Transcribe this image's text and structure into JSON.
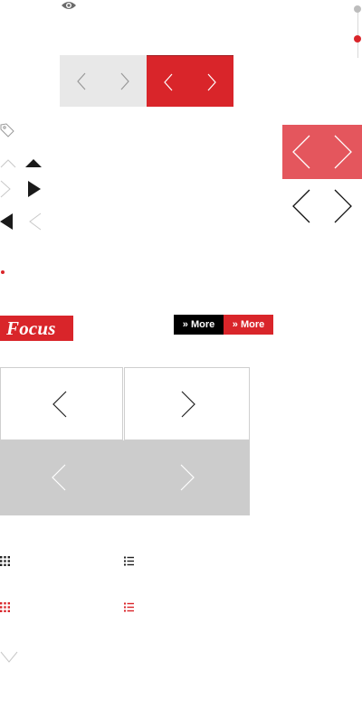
{
  "colors": {
    "accent": "#d9252a",
    "accent_light": "#e4565d",
    "gray_box": "#e8e8e8",
    "gray_band": "#cccccc"
  },
  "icons": {
    "eye": "eye-icon",
    "tag": "tag-icon",
    "arrows": "chevron-left-icon / chevron-right-icon",
    "triangles": "triangle-up / triangle-right / triangle-left",
    "grid": "grid-view-icon",
    "list": "list-view-icon",
    "chevron_down": "chevron-down-icon"
  },
  "slider": {
    "dots": 2,
    "active_index": 1
  },
  "focus_label": "Focus",
  "more_buttons": {
    "dark": "» More",
    "red": "» More"
  }
}
